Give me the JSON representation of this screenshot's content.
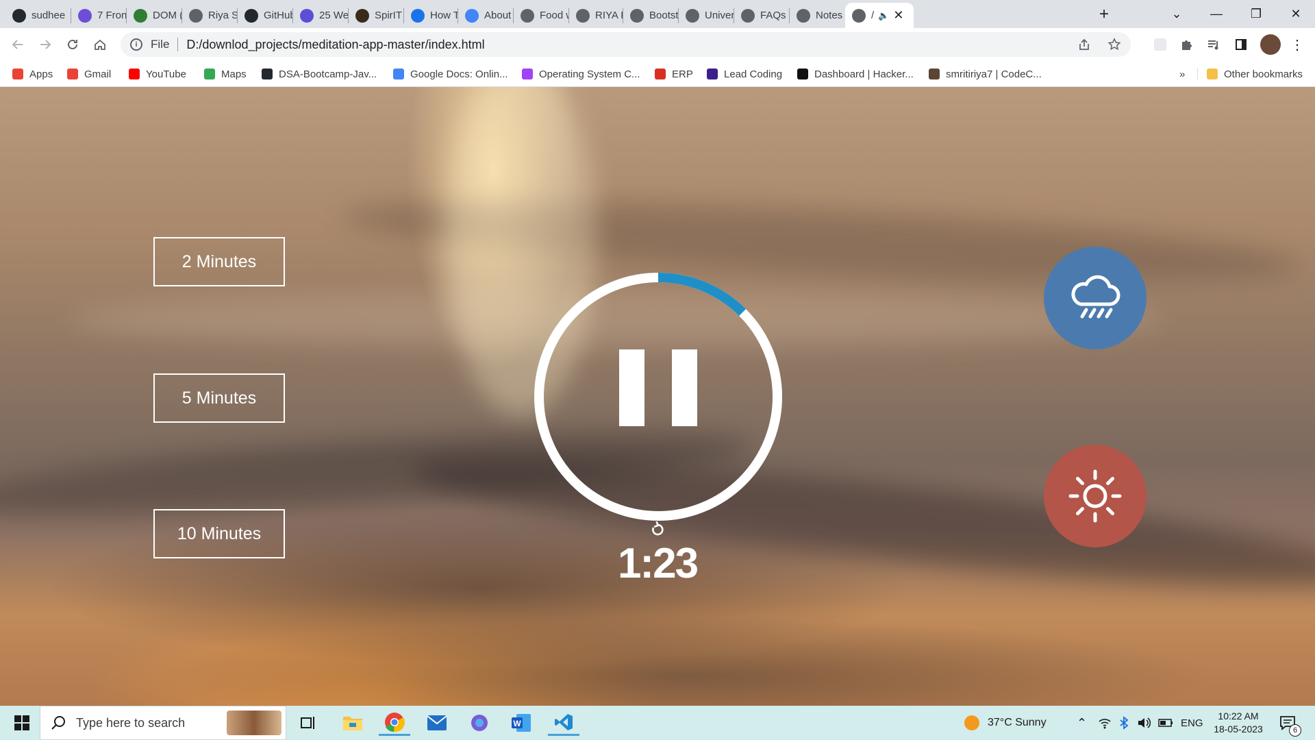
{
  "browser": {
    "tabs": [
      {
        "label": "sudhee",
        "icon": "github-icon",
        "color": "#24292f"
      },
      {
        "label": "7 Front",
        "icon": "m-logo-icon",
        "color": "#6c4fd6"
      },
      {
        "label": "DOM (l",
        "icon": "link-icon",
        "color": "#2e7d32"
      },
      {
        "label": "Riya Sr",
        "icon": "globe-icon",
        "color": "#5f6368"
      },
      {
        "label": "GitHub",
        "icon": "github-icon",
        "color": "#24292f"
      },
      {
        "label": "25 Wel",
        "icon": "h-logo-icon",
        "color": "#5b4fd6"
      },
      {
        "label": "SpirIT -",
        "icon": "book-icon",
        "color": "#3a2a1a"
      },
      {
        "label": "How To",
        "icon": "info-icon",
        "color": "#1a73e8"
      },
      {
        "label": "About",
        "icon": "google-icon",
        "color": "#4285f4"
      },
      {
        "label": "Food w",
        "icon": "globe-icon",
        "color": "#5f6368"
      },
      {
        "label": "RIYA FI",
        "icon": "globe-icon",
        "color": "#5f6368"
      },
      {
        "label": "Bootstr",
        "icon": "globe-icon",
        "color": "#5f6368"
      },
      {
        "label": "Univers",
        "icon": "globe-icon",
        "color": "#5f6368"
      },
      {
        "label": "FAQs",
        "icon": "globe-icon",
        "color": "#5f6368"
      },
      {
        "label": "Notes",
        "icon": "globe-icon",
        "color": "#5f6368"
      },
      {
        "label": "/",
        "icon": "globe-icon",
        "color": "#5f6368"
      }
    ],
    "address": {
      "scheme": "File",
      "url": "D:/downlod_projects/meditation-app-master/index.html"
    },
    "bookmarks": [
      {
        "label": "Apps",
        "color": "#ea4335"
      },
      {
        "label": "Gmail",
        "color": "#ea4335"
      },
      {
        "label": "YouTube",
        "color": "#ff0000"
      },
      {
        "label": "Maps",
        "color": "#34a853"
      },
      {
        "label": "DSA-Bootcamp-Jav...",
        "color": "#24292f"
      },
      {
        "label": "Google Docs: Onlin...",
        "color": "#4285f4"
      },
      {
        "label": "Operating System C...",
        "color": "#a142f4"
      },
      {
        "label": "ERP",
        "color": "#d93025"
      },
      {
        "label": "Lead Coding",
        "color": "#3c1e8c"
      },
      {
        "label": "Dashboard | Hacker...",
        "color": "#111111"
      },
      {
        "label": "smritiriya7 | CodeC...",
        "color": "#5b4636"
      }
    ],
    "bookmarks_more": "»",
    "other_bookmarks": "Other bookmarks"
  },
  "app": {
    "durations": [
      "2 Minutes",
      "5 Minutes",
      "10 Minutes"
    ],
    "time_display": "1:23",
    "progress": 0.125,
    "progress_color": "#1f8fc7",
    "sounds": [
      {
        "name": "rain",
        "color": "#4b7bae"
      },
      {
        "name": "sunny",
        "color": "#b4554a"
      }
    ]
  },
  "taskbar": {
    "search_placeholder": "Type here to search",
    "weather": "37°C  Sunny",
    "language": "ENG",
    "time": "10:22 AM",
    "date": "18-05-2023",
    "notifications": "6"
  }
}
